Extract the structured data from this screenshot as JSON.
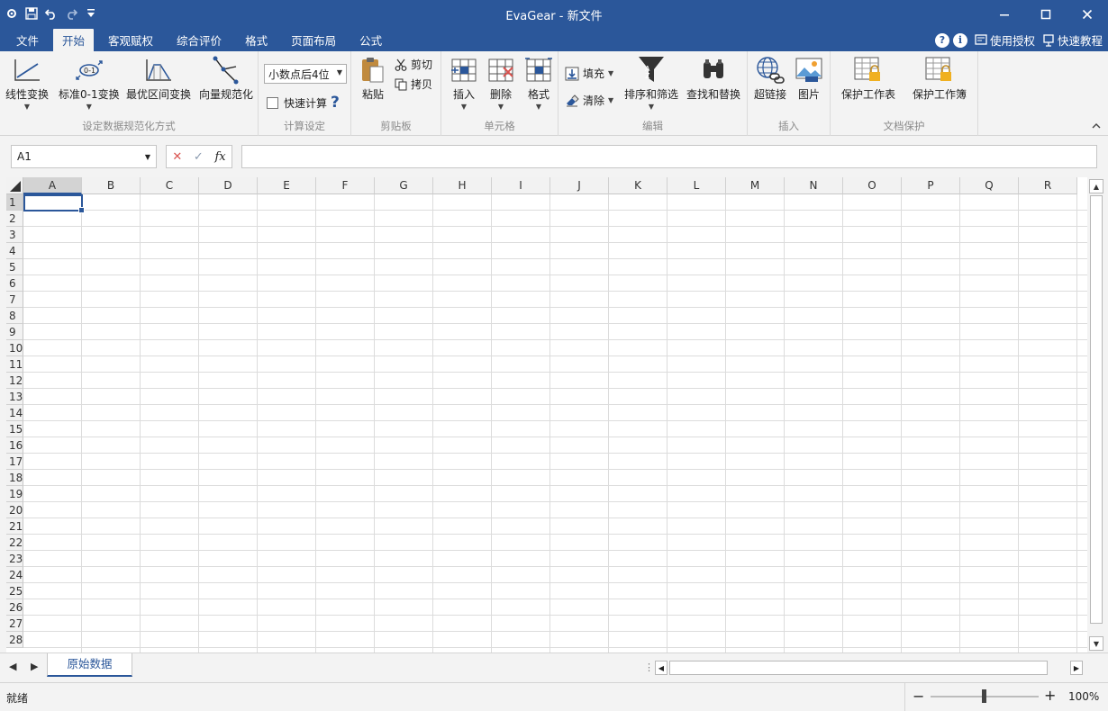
{
  "window": {
    "title": "EvaGear - 新文件",
    "icons": [
      "gear-icon",
      "save-icon",
      "undo-icon",
      "redo-icon",
      "customize-qat-icon"
    ],
    "controls": [
      "minimize-icon",
      "maximize-icon",
      "close-icon"
    ]
  },
  "tabs": [
    "文件",
    "开始",
    "客观赋权",
    "综合评价",
    "格式",
    "页面布局",
    "公式"
  ],
  "active_tab": "开始",
  "tabrow_right": {
    "help_glyph": "?",
    "info_glyph": "i",
    "license": "使用授权",
    "tutorial": "快速教程"
  },
  "ribbon": {
    "normalize": {
      "label": "设定数据规范化方式",
      "buttons": [
        "线性变换",
        "标准0-1变换",
        "最优区间变换",
        "向量规范化"
      ]
    },
    "calc": {
      "label": "计算设定",
      "decimal_select": "小数点后4位",
      "fast_calc": "快速计算",
      "help_glyph": "?"
    },
    "clipboard": {
      "label": "剪贴板",
      "paste": "粘贴",
      "cut": "剪切",
      "copy": "拷贝"
    },
    "cells": {
      "label": "单元格",
      "insert": "插入",
      "delete": "删除",
      "format": "格式"
    },
    "edit": {
      "label": "编辑",
      "fill": "填充",
      "clear": "清除",
      "sort_filter": "排序和筛选",
      "find_replace": "查找和替换"
    },
    "insert": {
      "label": "插入",
      "hyperlink": "超链接",
      "picture": "图片"
    },
    "protect": {
      "label": "文档保护",
      "sheet": "保护工作表",
      "workbook": "保护工作簿"
    }
  },
  "formula_bar": {
    "name_box": "A1",
    "cancel_glyph": "✕",
    "confirm_glyph": "✓",
    "fx": "fx",
    "value": ""
  },
  "grid": {
    "columns": [
      "A",
      "B",
      "C",
      "D",
      "E",
      "F",
      "G",
      "H",
      "I",
      "J",
      "K",
      "L",
      "M",
      "N",
      "O",
      "P",
      "Q",
      "R"
    ],
    "rows": [
      "1",
      "2",
      "3",
      "4",
      "5",
      "6",
      "7",
      "8",
      "9",
      "10",
      "11",
      "12",
      "13",
      "14",
      "15",
      "16",
      "17",
      "18",
      "19",
      "20",
      "21",
      "22",
      "23",
      "24",
      "25",
      "26",
      "27",
      "28"
    ],
    "active_cell": "A1"
  },
  "sheets": [
    "原始数据"
  ],
  "status": {
    "text": "就绪",
    "zoom": "100%",
    "zoom_minus": "−",
    "zoom_plus": "+"
  },
  "colors": {
    "accent": "#2b579a",
    "ribbon_bg": "#f3f3f3"
  }
}
